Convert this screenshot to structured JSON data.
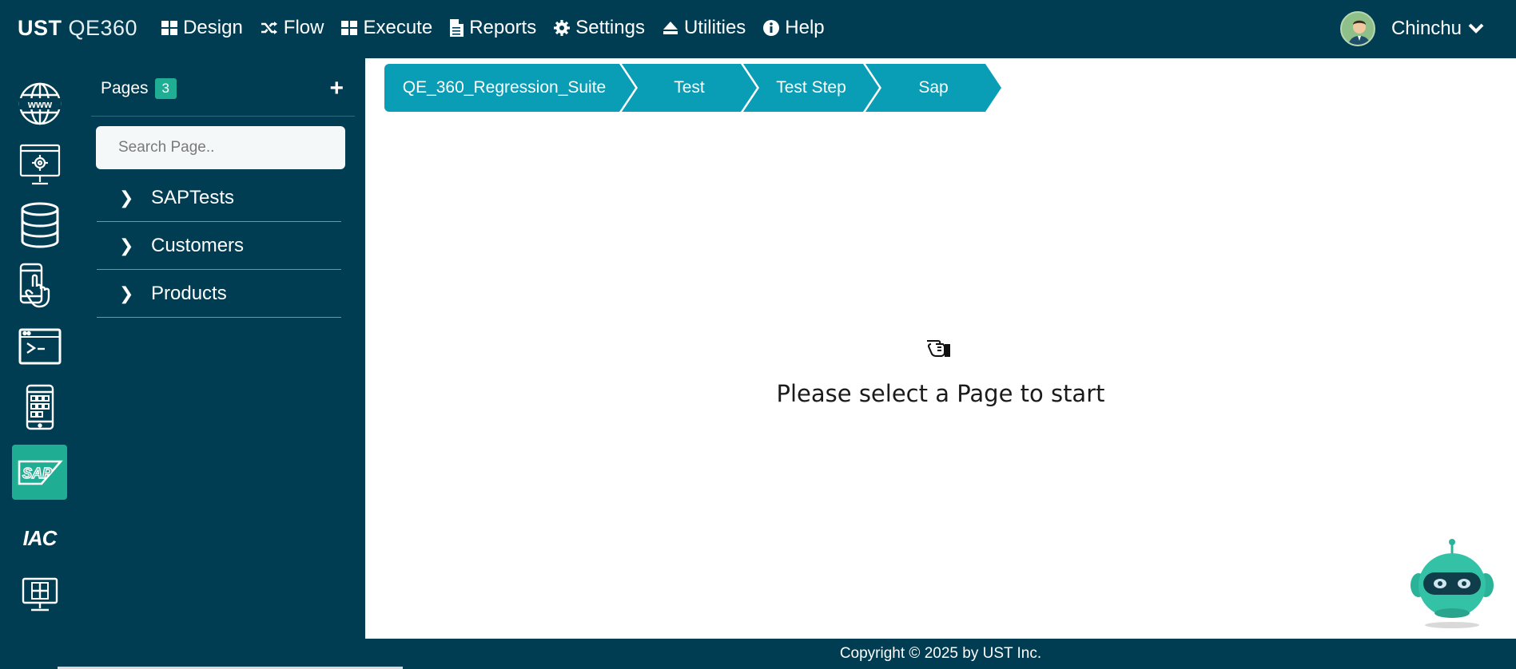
{
  "brand": {
    "strong": "UST",
    "light": "QE360"
  },
  "nav": [
    {
      "label": "Design",
      "icon": "grid-icon"
    },
    {
      "label": "Flow",
      "icon": "shuffle-icon"
    },
    {
      "label": "Execute",
      "icon": "grid-icon"
    },
    {
      "label": "Reports",
      "icon": "document-icon"
    },
    {
      "label": "Settings",
      "icon": "gear-icon"
    },
    {
      "label": "Utilities",
      "icon": "eject-icon"
    },
    {
      "label": "Help",
      "icon": "info-icon"
    }
  ],
  "user": {
    "name": "Chinchu"
  },
  "rail": {
    "items": [
      "web-globe-icon",
      "desktop-settings-icon",
      "database-icon",
      "mobile-touch-icon",
      "terminal-icon",
      "mobile-apps-icon",
      "sap-icon",
      "iac-icon",
      "windows-monitor-icon"
    ],
    "iac_label": "IAC",
    "active": "sap-icon",
    "active_color": "#1fae93"
  },
  "pages": {
    "title": "Pages",
    "count": "3",
    "add_label": "+",
    "search_placeholder": "Search Page..",
    "items": [
      "SAPTests",
      "Customers",
      "Products"
    ]
  },
  "breadcrumb": [
    "QE_360_Regression_Suite",
    "Test",
    "Test Step",
    "Sap"
  ],
  "main": {
    "empty_message": "Please select a Page to start"
  },
  "footer": {
    "copyright": "Copyright © 2025 by UST Inc."
  },
  "colors": {
    "navy": "#003d52",
    "teal": "#0a9db6",
    "green": "#1fae93"
  }
}
